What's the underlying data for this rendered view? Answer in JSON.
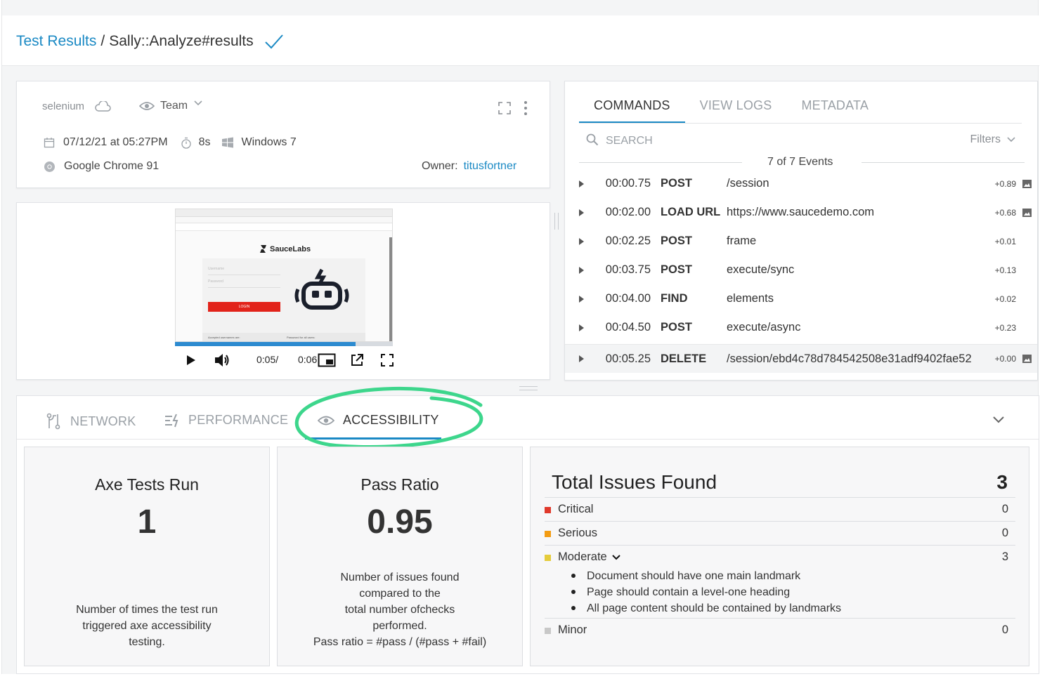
{
  "breadcrumb": {
    "link": "Test Results",
    "separator": "/",
    "current": "Sally::Analyze#results"
  },
  "info": {
    "framework": "selenium",
    "visibility": "Team",
    "date": "07/12/21 at 05:27PM",
    "duration": "8s",
    "os": "Windows 7",
    "browser": "Google Chrome 91",
    "owner_label": "Owner:",
    "owner": "titusfortner"
  },
  "video": {
    "brand": "SauceLabs",
    "username_placeholder": "Username",
    "password_placeholder": "Password",
    "login_label": "LOGIN",
    "accepted_usernames": "Accepted usernames are:",
    "password_for_all": "Password for all users:",
    "current_time": "0:05/",
    "total_time": "0:06",
    "progress": 0.83
  },
  "commands": {
    "tabs": [
      "COMMANDS",
      "VIEW LOGS",
      "METADATA"
    ],
    "search_placeholder": "SEARCH",
    "filters_label": "Filters",
    "events_count": "7 of 7 Events",
    "rows": [
      {
        "time": "00:00.75",
        "verb": "POST",
        "path": "/session",
        "delta": "+0.89",
        "has_image": true
      },
      {
        "time": "00:02.00",
        "verb": "LOAD URL",
        "path": "https://www.saucedemo.com",
        "delta": "+0.68",
        "has_image": true
      },
      {
        "time": "00:02.25",
        "verb": "POST",
        "path": "frame",
        "delta": "+0.01",
        "has_image": false
      },
      {
        "time": "00:03.75",
        "verb": "POST",
        "path": "execute/sync",
        "delta": "+0.13",
        "has_image": false
      },
      {
        "time": "00:04.00",
        "verb": "FIND",
        "path": "elements",
        "delta": "+0.02",
        "has_image": false
      },
      {
        "time": "00:04.50",
        "verb": "POST",
        "path": "execute/async",
        "delta": "+0.23",
        "has_image": false
      },
      {
        "time": "00:05.25",
        "verb": "DELETE",
        "path": "/session/ebd4c78d784542508e31adf9402fae52",
        "delta": "+0.00",
        "has_image": true
      }
    ]
  },
  "bottom_tabs": {
    "network": "NETWORK",
    "performance": "PERFORMANCE",
    "accessibility": "ACCESSIBILITY"
  },
  "axe_panel": {
    "title": "Axe Tests Run",
    "value": "1",
    "description": "Number of times the test run triggered axe accessibility testing."
  },
  "pass_panel": {
    "title": "Pass Ratio",
    "value": "0.95",
    "desc_line1": "Number of issues found",
    "desc_line2": "compared to the",
    "desc_line3": "total number ofchecks",
    "desc_line4": "performed.",
    "desc_line5": "Pass ratio = #pass / (#pass + #fail)"
  },
  "issues": {
    "title": "Total Issues Found",
    "total": "3",
    "critical": {
      "label": "Critical",
      "count": "0",
      "color": "#e0392b"
    },
    "serious": {
      "label": "Serious",
      "count": "0",
      "color": "#f39c12"
    },
    "moderate": {
      "label": "Moderate",
      "count": "3",
      "color": "#e5cc3b",
      "items": [
        "Document should have one main landmark",
        "Page should contain a level-one heading",
        "All page content should be contained by landmarks"
      ]
    },
    "minor": {
      "label": "Minor",
      "count": "0",
      "color": "#c8c8c8"
    }
  },
  "colors": {
    "accent": "#1a89c4",
    "highlight_ring": "#3dd68c"
  }
}
